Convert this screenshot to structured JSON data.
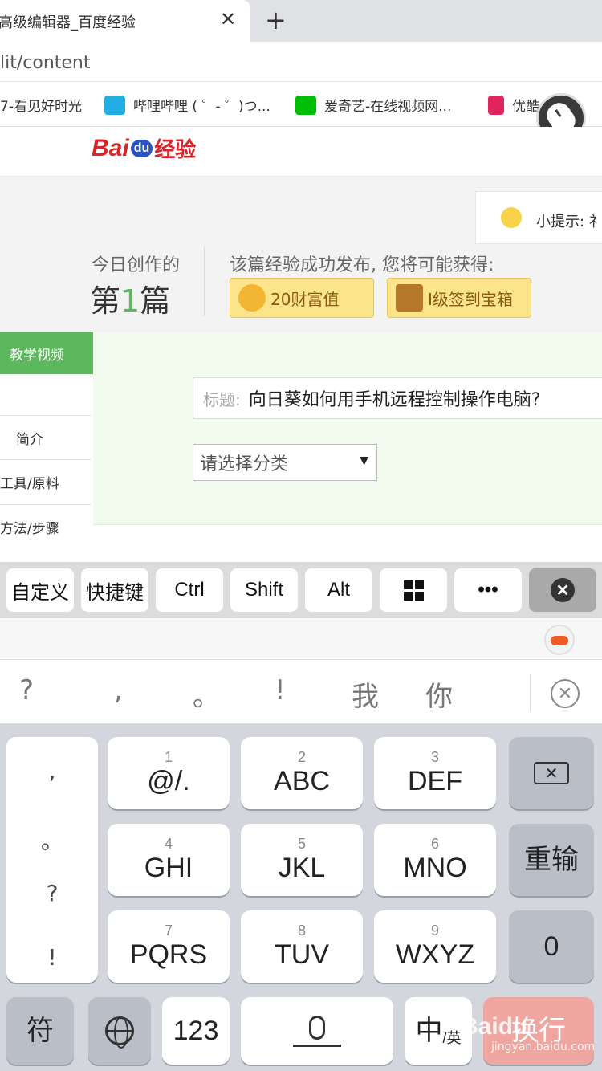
{
  "browser": {
    "tab_title": "高级编辑器_百度经验",
    "tab_close": "✕",
    "new_tab": "+",
    "url": "lit/content",
    "bookmarks": [
      {
        "label": "7-看见好时光",
        "icon": "video-icon",
        "color": "#f5a623"
      },
      {
        "label": "哔哩哔哩 ( ゜- ゜)つ...",
        "icon": "bilibili-icon",
        "color": "#23ade5"
      },
      {
        "label": "爱奇艺-在线视频网...",
        "icon": "iqiyi-icon",
        "color": "#00be06"
      },
      {
        "label": "优酷",
        "icon": "youku-icon",
        "color": "#e0245e"
      }
    ]
  },
  "page": {
    "logo": {
      "bai": "Bai",
      "du": "du",
      "jingyan": "经验"
    },
    "tip": "小提示: 礻",
    "today_label": "今日创作的",
    "today_prefix": "第",
    "today_num": "1",
    "today_suffix": "篇",
    "reward_label": "该篇经验成功发布, 您将可能获得:",
    "rewards": [
      {
        "label": "20财富值",
        "icon": "coin-icon",
        "color": "#f3b632"
      },
      {
        "label": "I级签到宝箱",
        "icon": "treasure-chest-icon",
        "color": "#b5782a"
      }
    ],
    "sidebar": {
      "active": "教学视频",
      "items": [
        "简介",
        "工具/原料",
        "方法/步骤"
      ]
    },
    "title_label": "标题:",
    "title_value": "向日葵如何用手机远程控制操作电脑?",
    "category_placeholder": "请选择分类",
    "category_arrow": "▼"
  },
  "remote_toolbar": {
    "keys": [
      "自定义",
      "快捷键",
      "Ctrl",
      "Shift",
      "Alt"
    ],
    "more": "•••",
    "close": "✕"
  },
  "ime": {
    "candidates": [
      "?",
      ",",
      "。",
      "!",
      "我",
      "你"
    ],
    "clear": "✕"
  },
  "keyboard": {
    "punct_column": [
      ",",
      "。",
      "?",
      "!"
    ],
    "rows": [
      [
        {
          "num": "1",
          "label": "@/."
        },
        {
          "num": "2",
          "label": "ABC"
        },
        {
          "num": "3",
          "label": "DEF"
        }
      ],
      [
        {
          "num": "4",
          "label": "GHI"
        },
        {
          "num": "5",
          "label": "JKL"
        },
        {
          "num": "6",
          "label": "MNO"
        }
      ],
      [
        {
          "num": "7",
          "label": "PQRS"
        },
        {
          "num": "8",
          "label": "TUV"
        },
        {
          "num": "9",
          "label": "WXYZ"
        }
      ]
    ],
    "backspace": "✕",
    "reinput": "重输",
    "zero": "0",
    "symbol": "符",
    "num_mode": "123",
    "lang_main": "中",
    "lang_sub": "/英",
    "enter": "换行"
  },
  "watermark": {
    "main": "Baidu",
    "sub": "jingyan.baidu.com"
  }
}
